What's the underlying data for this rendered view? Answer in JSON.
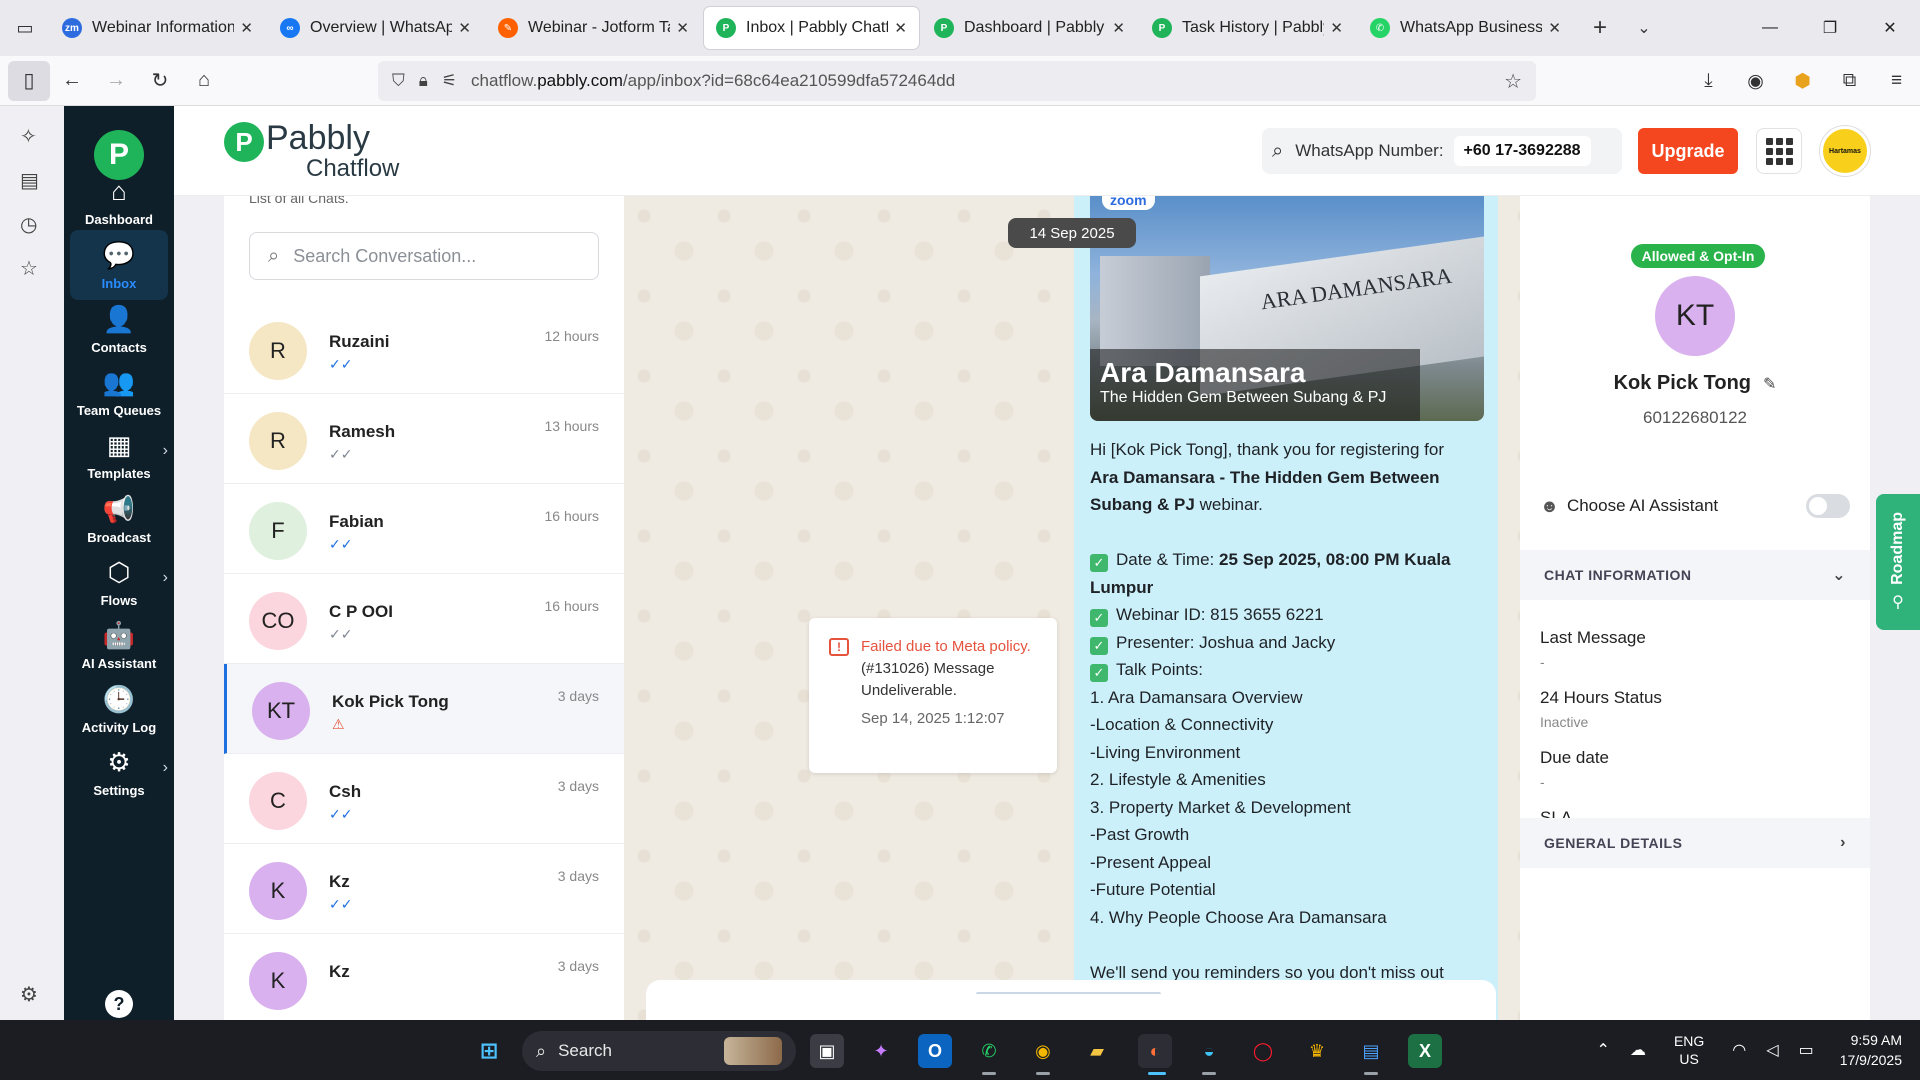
{
  "browser": {
    "tabs": [
      {
        "title": "Webinar Information -",
        "favicon": "zm",
        "color": "#2d6cdf"
      },
      {
        "title": "Overview | WhatsApp",
        "favicon": "∞",
        "color": "#1877f2"
      },
      {
        "title": "Webinar - Jotform Tab",
        "favicon": "✎",
        "color": "#ff6100"
      },
      {
        "title": "Inbox | Pabbly Chatflo",
        "favicon": "P",
        "color": "#1fb45a"
      },
      {
        "title": "Dashboard | Pabbly Co",
        "favicon": "P",
        "color": "#1fb45a"
      },
      {
        "title": "Task History | Pabbly C",
        "favicon": "P",
        "color": "#1fb45a"
      },
      {
        "title": "WhatsApp Business",
        "favicon": "✆",
        "color": "#25d366"
      }
    ],
    "url_prefix": "chatflow.",
    "url_domain": "pabbly.com",
    "url_path": "/app/inbox?id=68c64ea210599dfa572464dd"
  },
  "sidebar": {
    "items": [
      {
        "label": "Dashboard",
        "icon": "⌂"
      },
      {
        "label": "Inbox",
        "icon": "💬"
      },
      {
        "label": "Contacts",
        "icon": "👤"
      },
      {
        "label": "Team Queues",
        "icon": "👥"
      },
      {
        "label": "Templates",
        "icon": "▦"
      },
      {
        "label": "Broadcast",
        "icon": "📢"
      },
      {
        "label": "Flows",
        "icon": "⬡"
      },
      {
        "label": "AI Assistant",
        "icon": "🤖"
      },
      {
        "label": "Activity Log",
        "icon": "🕒"
      },
      {
        "label": "Settings",
        "icon": "⚙"
      }
    ],
    "help": "?"
  },
  "header": {
    "brand_line1": "Pabbly",
    "brand_line2": "Chatflow",
    "wa_label": "WhatsApp Number:",
    "wa_number": "+60 17-3692288",
    "upgrade_label": "Upgrade",
    "avatar_text": "Hartamas"
  },
  "conversations": {
    "cut_label": "List of all Chats.",
    "search_placeholder": "Search Conversation...",
    "items": [
      {
        "initials": "R",
        "name": "Ruzaini",
        "time": "12 hours",
        "status": "✓✓",
        "bg": "#f5e6c4"
      },
      {
        "initials": "R",
        "name": "Ramesh",
        "time": "13 hours",
        "status": "✓✓",
        "bg": "#f5e6c4"
      },
      {
        "initials": "F",
        "name": "Fabian",
        "time": "16 hours",
        "status": "✓✓",
        "bg": "#dff0de"
      },
      {
        "initials": "CO",
        "name": "C P OOI",
        "time": "16 hours",
        "status": "✓✓",
        "bg": "#fbd6de"
      },
      {
        "initials": "KT",
        "name": "Kok Pick Tong",
        "time": "3 days",
        "status": "⚠",
        "bg": "#d9b1ee"
      },
      {
        "initials": "C",
        "name": "Csh",
        "time": "3 days",
        "status": "✓✓",
        "bg": "#fbd6de"
      },
      {
        "initials": "K",
        "name": "Kz",
        "time": "3 days",
        "status": "✓✓",
        "bg": "#d9b1ee"
      },
      {
        "initials": "K",
        "name": "Kz",
        "time": "3 days",
        "status": "",
        "bg": "#d9b1ee"
      }
    ]
  },
  "chat": {
    "date_chip": "14 Sep 2025",
    "image_zoom": "zoom",
    "image_sign": "ARA DAMANSARA",
    "image_title": "Ara Damansara",
    "image_subtitle": "The Hidden Gem Between Subang & PJ",
    "msg_intro_1": "Hi [Kok Pick Tong], thank you for registering for",
    "msg_intro_2": "Ara Damansara - The Hidden Gem Between",
    "msg_intro_3": "Subang & PJ",
    "msg_intro_4": " webinar.",
    "dt_label": "Date & Time: ",
    "dt_value_1": "25 Sep 2025, 08:00 PM Kuala",
    "dt_value_2": "Lumpur",
    "webinar_id": "Webinar ID: 815 3655 6221",
    "presenter": "Presenter: Joshua and Jacky",
    "talk_points": "Talk Points:",
    "points": [
      "1. Ara Damansara Overview",
      "-Location & Connectivity",
      "-Living Environment",
      "2. Lifestyle & Amenities",
      "3. Property Market & Development",
      "-Past Growth",
      "-Present Appeal",
      "-Future Potential",
      "4. Why People Choose Ara Damansara"
    ],
    "closing": "We'll send you reminders so you don't miss out",
    "fail_title": "Failed due to Meta policy.",
    "fail_body": "(#131026) Message Undeliverable.",
    "fail_time": "Sep 14, 2025 1:12:07"
  },
  "contact": {
    "badge": "Allowed & Opt-In",
    "initials": "KT",
    "name": "Kok Pick Tong",
    "phone": "60122680122",
    "ai_label": "Choose AI Assistant",
    "chat_info_head": "CHAT INFORMATION",
    "fields": [
      {
        "label": "Last Message",
        "value": "-"
      },
      {
        "label": "24 Hours Status",
        "value": "Inactive"
      },
      {
        "label": "Due date",
        "value": "-"
      },
      {
        "label": "SLA",
        "value": "-"
      }
    ],
    "general_head": "GENERAL DETAILS",
    "roadmap": "Roadmap"
  },
  "taskbar": {
    "search_label": "Search",
    "lang_1": "ENG",
    "lang_2": "US",
    "time": "9:59 AM",
    "date": "17/9/2025"
  }
}
